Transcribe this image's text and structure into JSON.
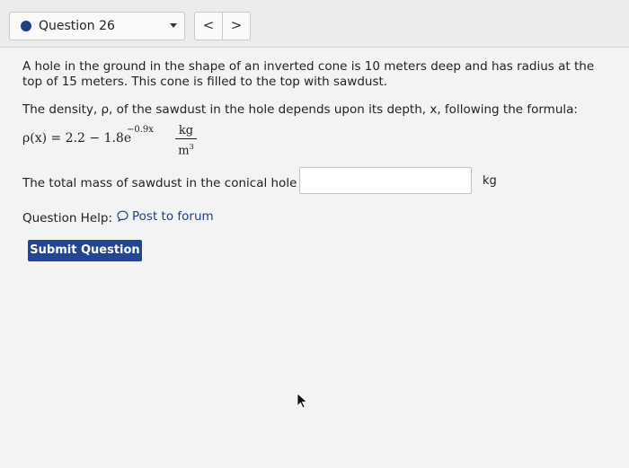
{
  "header": {
    "question_label": "Question 26",
    "prev_glyph": "<",
    "next_glyph": ">"
  },
  "problem": {
    "statement": "A hole in the ground in the shape of an inverted cone is 10 meters deep and has radius at the top of 15 meters. This cone is filled to the top with sawdust.",
    "density_intro": "The density, ρ, of the sawdust in the hole depends upon its depth, x, following the formula:",
    "formula": {
      "lhs": "ρ(x) = 2.2 − 1.8e",
      "exponent": "−0.9x",
      "unit_numerator": "kg",
      "unit_denominator": "m",
      "unit_denominator_power": "3"
    }
  },
  "answer": {
    "prompt": "The total mass of sawdust in the conical hole is:",
    "value": "",
    "unit": "kg"
  },
  "help": {
    "label": "Question Help:",
    "forum_link": "Post to forum"
  },
  "actions": {
    "submit_label": "Submit Question"
  },
  "colors": {
    "accent": "#24458f",
    "link": "#1f3f86",
    "status_dot": "#1f3f86"
  }
}
